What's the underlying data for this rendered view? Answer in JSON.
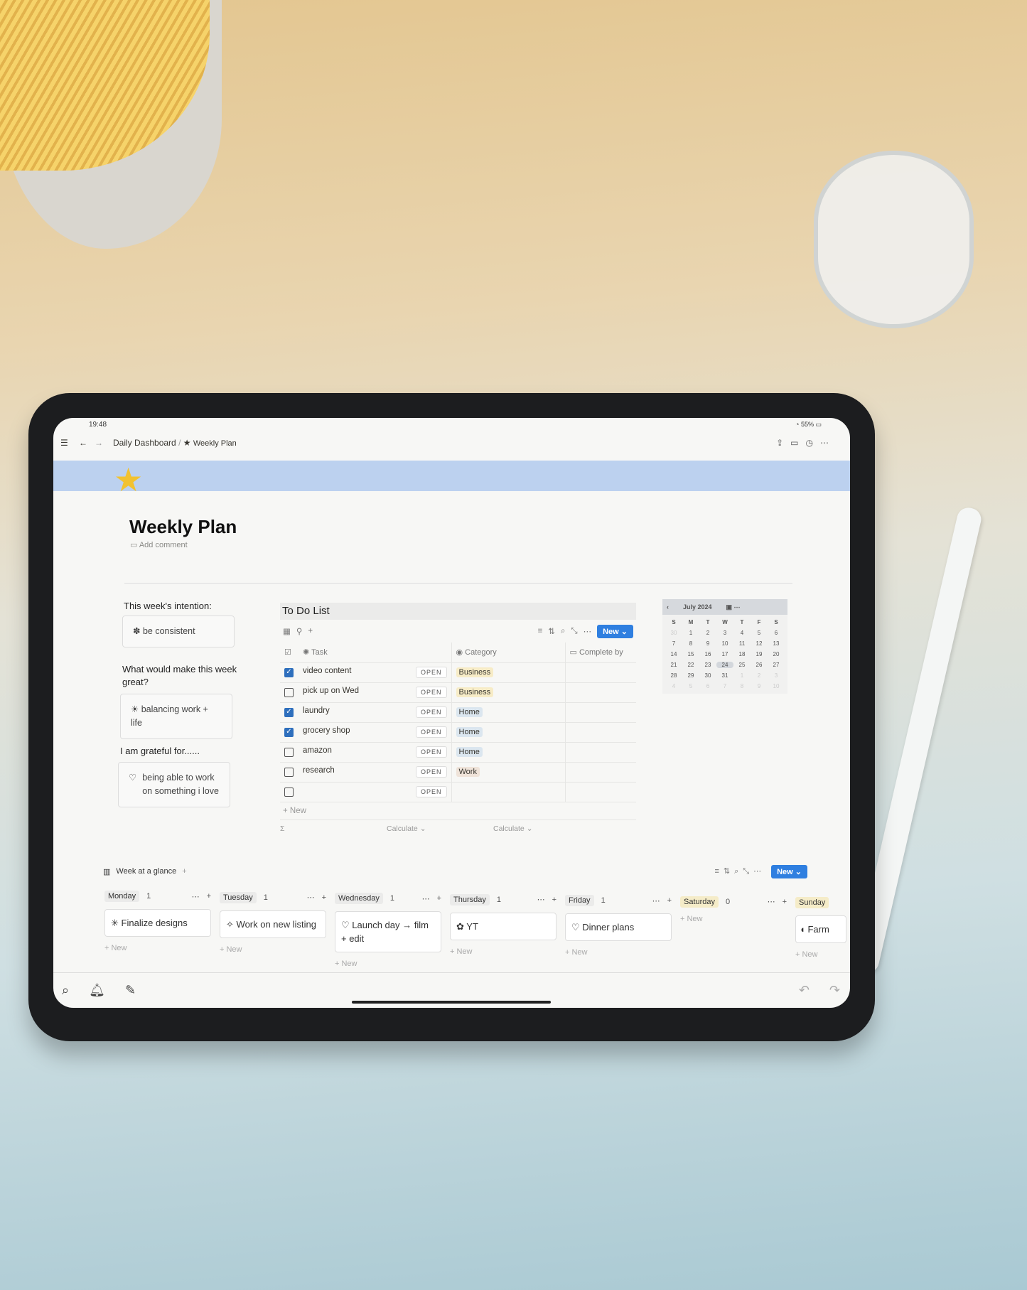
{
  "status": {
    "time": "19:48",
    "battery": "55%"
  },
  "nav": {
    "breadcrumb_parent": "Daily Dashboard",
    "separator": "/",
    "breadcrumb_current": "Weekly Plan"
  },
  "page": {
    "title": "Weekly Plan",
    "add_comment": "Add comment",
    "icon": "star-icon"
  },
  "left": {
    "intention_label": "This week's intention:",
    "intention_value": "be consistent",
    "great_label": "What would make this week great?",
    "great_value": "balancing work + life",
    "grateful_label": "I am grateful for......",
    "grateful_value": "being able to work on something i love"
  },
  "todo": {
    "title": "To Do List",
    "new_label": "New",
    "add_new": "New",
    "calculate": "Calculate",
    "sigma": "Σ",
    "columns": [
      "Task",
      "Category",
      "Complete by"
    ],
    "open_label": "OPEN",
    "rows": [
      {
        "task": "video content",
        "done": true,
        "category": "Business"
      },
      {
        "task": "pick up on Wed",
        "done": false,
        "category": "Business"
      },
      {
        "task": "laundry",
        "done": true,
        "category": "Home"
      },
      {
        "task": "grocery shop",
        "done": true,
        "category": "Home"
      },
      {
        "task": "amazon",
        "done": false,
        "category": "Home"
      },
      {
        "task": "research",
        "done": false,
        "category": "Work"
      },
      {
        "task": "",
        "done": false,
        "category": ""
      }
    ],
    "category_colors": {
      "Business": "#f7ecc7",
      "Home": "#dbe6ef",
      "Work": "#efe3d9"
    }
  },
  "calendar": {
    "month": "July 2024",
    "weekdays": [
      "S",
      "M",
      "T",
      "W",
      "T",
      "F",
      "S"
    ],
    "days": [
      "30",
      "1",
      "2",
      "3",
      "4",
      "5",
      "6",
      "7",
      "8",
      "9",
      "10",
      "11",
      "12",
      "13",
      "14",
      "15",
      "16",
      "17",
      "18",
      "19",
      "20",
      "21",
      "22",
      "23",
      "24",
      "25",
      "26",
      "27",
      "28",
      "29",
      "30",
      "31",
      "1",
      "2",
      "3",
      "4",
      "5",
      "6",
      "7",
      "8",
      "9",
      "10"
    ],
    "today": "24"
  },
  "week": {
    "title": "Week at a glance",
    "new_label": "New",
    "add_new": "New",
    "days": [
      {
        "name": "Monday",
        "count": "1",
        "card": "Finalize designs",
        "icon": "asterisk-icon"
      },
      {
        "name": "Tuesday",
        "count": "1",
        "card": "Work on new listing",
        "icon": "sparkle-icon"
      },
      {
        "name": "Wednesday",
        "count": "1",
        "card": "Launch day → film + edit",
        "icon": "heart-icon"
      },
      {
        "name": "Thursday",
        "count": "1",
        "card": "YT",
        "icon": "flower-icon"
      },
      {
        "name": "Friday",
        "count": "1",
        "card": "Dinner plans",
        "icon": "heart-icon"
      },
      {
        "name": "Saturday",
        "count": "0",
        "card": "",
        "icon": ""
      },
      {
        "name": "Sunday",
        "count": "",
        "card": "Farm",
        "icon": "pear-icon"
      }
    ]
  },
  "colors": {
    "accent": "#2f7fe0",
    "banner": "#bcd1ef"
  }
}
